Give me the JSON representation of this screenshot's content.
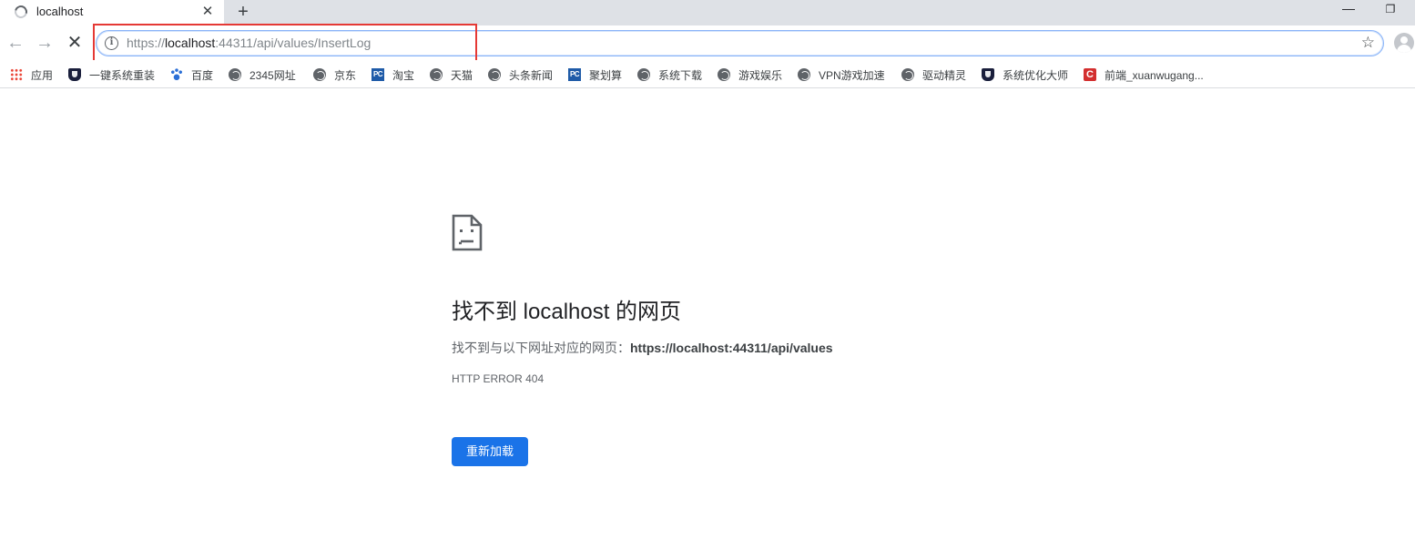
{
  "tab": {
    "title": "localhost",
    "close_label": "✕",
    "new_tab_label": "+"
  },
  "window": {
    "minimize_label": "—",
    "restore_label": "❐"
  },
  "toolbar": {
    "back_label": "←",
    "forward_label": "→",
    "stop_label": "✕",
    "url_scheme": "https://",
    "url_host": "localhost",
    "url_rest": ":44311/api/values/InsertLog",
    "star_label": "☆"
  },
  "bookmarks": [
    {
      "label": "应用",
      "icon": "apps-grid-icon"
    },
    {
      "label": "一键系统重装",
      "icon": "shield-icon"
    },
    {
      "label": "百度",
      "icon": "baidu-paw-icon"
    },
    {
      "label": "2345网址",
      "icon": "globe-icon"
    },
    {
      "label": "京东",
      "icon": "globe-icon"
    },
    {
      "label": "淘宝",
      "icon": "pc-icon"
    },
    {
      "label": "天猫",
      "icon": "globe-icon"
    },
    {
      "label": "头条新闻",
      "icon": "globe-icon"
    },
    {
      "label": "聚划算",
      "icon": "pc-icon"
    },
    {
      "label": "系统下载",
      "icon": "globe-icon"
    },
    {
      "label": "游戏娱乐",
      "icon": "globe-icon"
    },
    {
      "label": "VPN游戏加速",
      "icon": "globe-icon"
    },
    {
      "label": "驱动精灵",
      "icon": "globe-icon"
    },
    {
      "label": "系统优化大师",
      "icon": "shield-icon"
    },
    {
      "label": "前端_xuanwugang...",
      "icon": "csdn-c-icon"
    }
  ],
  "icon_glyphs": {
    "pc": "PC",
    "c": "C",
    "info": "i"
  },
  "error": {
    "title": "找不到 localhost 的网页",
    "desc_prefix": "找不到与以下网址对应的网页：",
    "desc_url": "https://localhost:44311/api/values",
    "code": "HTTP ERROR 404",
    "reload_label": "重新加载"
  },
  "colors": {
    "highlight_box": "#e53935",
    "reload_button": "#1a73e8",
    "tab_strip": "#dee1e6"
  }
}
